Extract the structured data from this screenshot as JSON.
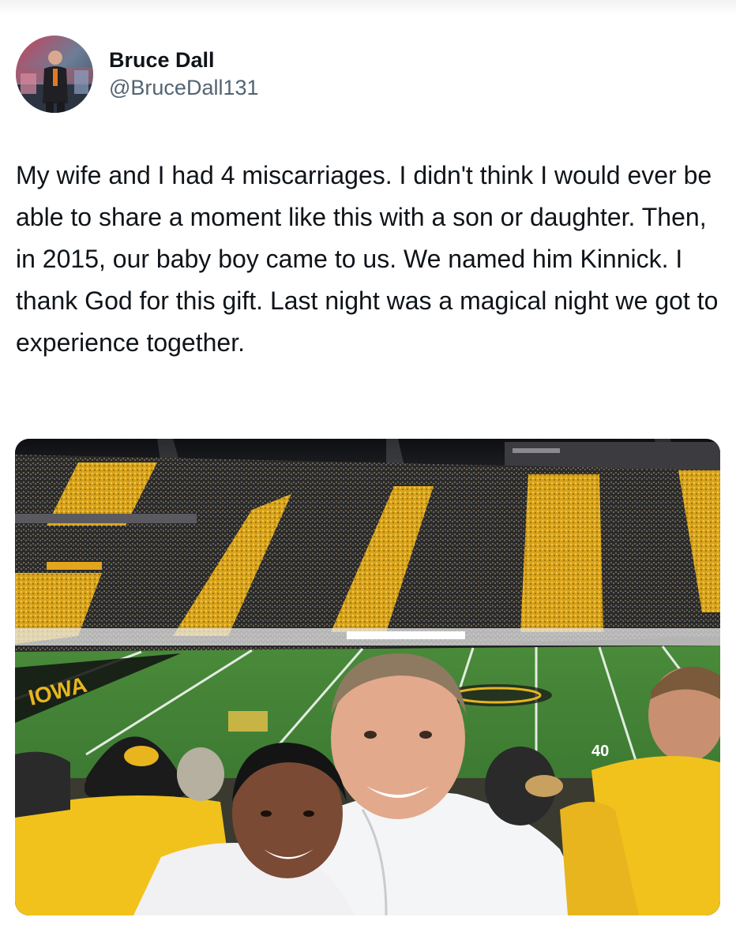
{
  "tweet": {
    "author": {
      "display_name": "Bruce Dall",
      "handle": "@BruceDall131"
    },
    "text": "My wife and I had 4 miscarriages. I didn't think I would ever be able to share a moment like this with a son or daughter. Then, in 2015, our baby boy came to us. We named him Kinnick. I thank God for this gift. Last night was a magical night we got to experience together.",
    "media": {
      "field_yard_label": "40",
      "colors": {
        "gold": "#e8b51f",
        "black": "#1b1b1b",
        "field_green": "#3f7a34"
      }
    }
  },
  "icons": {
    "avatar": "profile-photo",
    "cap_logo": "hawkeye-logo"
  }
}
